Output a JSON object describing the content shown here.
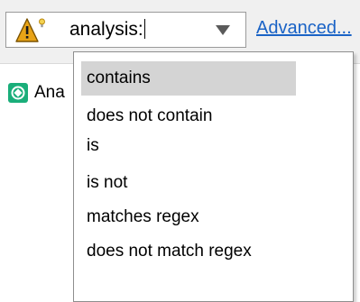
{
  "filter": {
    "value": "analysis:",
    "warning_icon": "warning-lightbulb-icon",
    "dropdown_icon": "triangle-down-icon"
  },
  "advanced_link": "Advanced...",
  "tab": {
    "label": "Ana",
    "icon": "analysis-icon",
    "icon_color": "#1aae7a"
  },
  "menu": {
    "items": [
      {
        "label": "contains",
        "selected": true
      },
      {
        "label": "does not contain",
        "selected": false
      },
      {
        "label": "is",
        "selected": false
      },
      {
        "label": "is not",
        "selected": false
      },
      {
        "label": "matches regex",
        "selected": false
      },
      {
        "label": "does not match regex",
        "selected": false
      }
    ]
  },
  "colors": {
    "link": "#1a63c6",
    "selection": "#d4d4d4",
    "warning": "#e8a317"
  }
}
